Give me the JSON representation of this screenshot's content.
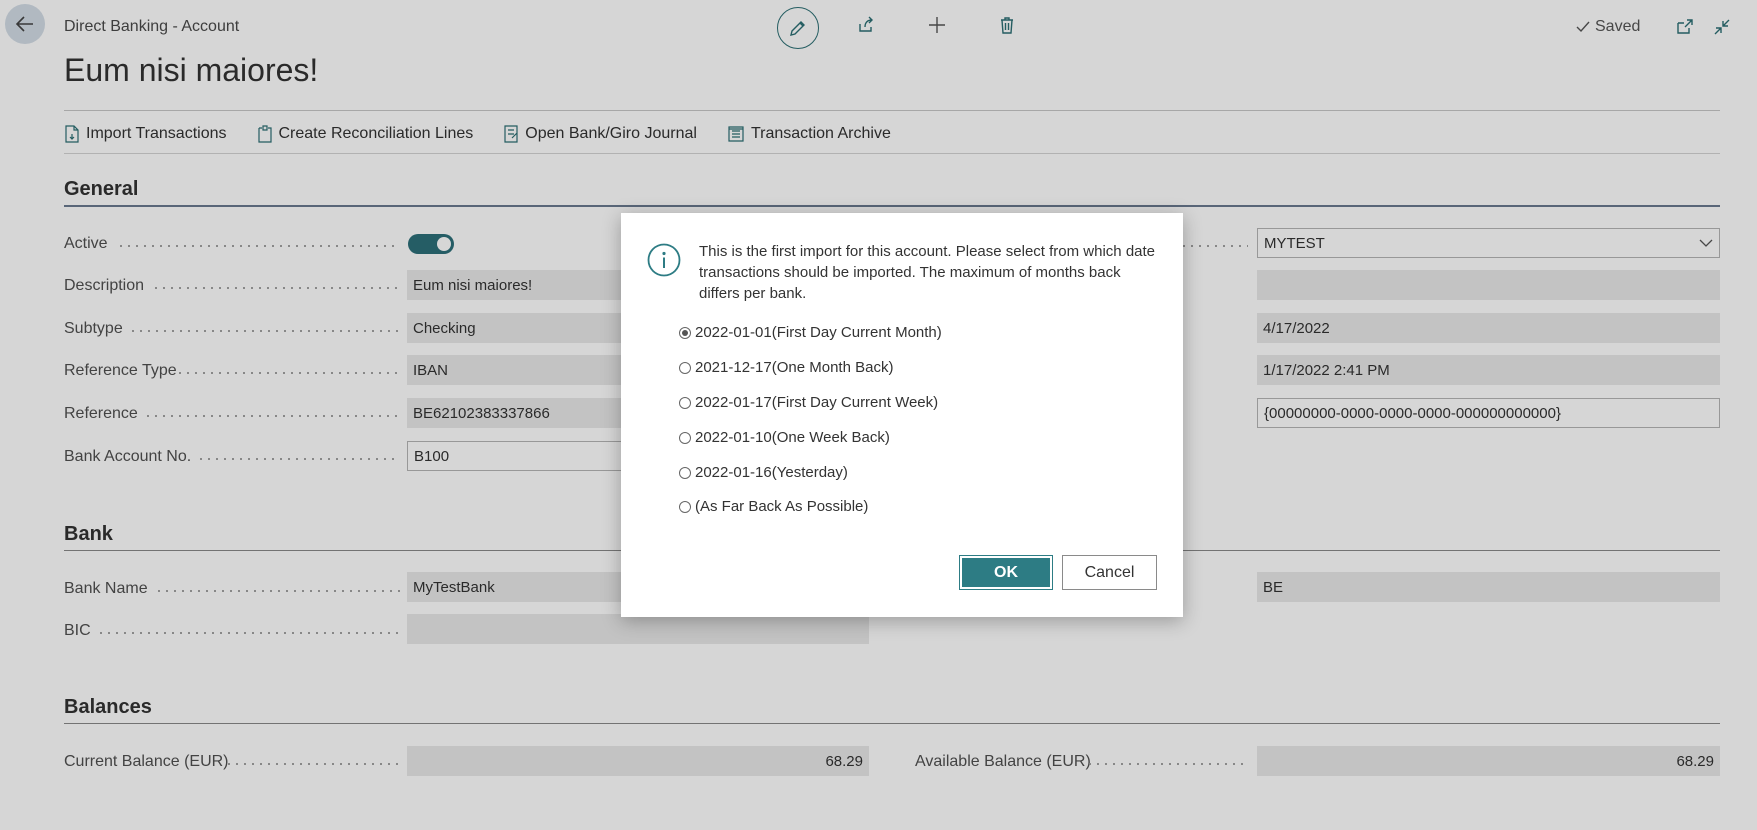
{
  "header": {
    "breadcrumb": "Direct Banking - Account",
    "title": "Eum nisi maiores!",
    "saved_label": "Saved"
  },
  "actions": [
    {
      "label": "Import Transactions",
      "icon": "import-file-icon"
    },
    {
      "label": "Create Reconciliation Lines",
      "icon": "create-lines-icon"
    },
    {
      "label": "Open Bank/Giro Journal",
      "icon": "journal-icon"
    },
    {
      "label": "Transaction Archive",
      "icon": "archive-icon"
    }
  ],
  "general": {
    "title": "General",
    "active_label": "Active",
    "active_value": true,
    "description_label": "Description",
    "description_value": "Eum nisi maiores!",
    "subtype_label": "Subtype",
    "subtype_value": "Checking",
    "reference_type_label": "Reference Type",
    "reference_type_value": "IBAN",
    "reference_label": "Reference",
    "reference_value": "BE62102383337866",
    "bank_account_label": "Bank Account No.",
    "bank_account_value": "B100",
    "right_values": {
      "select_value": "MYTEST",
      "empty_value": "",
      "date_value": "4/17/2022",
      "datetime_value": "1/17/2022 2:41 PM",
      "guid_value": "{00000000-0000-0000-0000-000000000000}"
    }
  },
  "bank": {
    "title": "Bank",
    "bank_name_label": "Bank Name",
    "bank_name_value": "MyTestBank",
    "bic_label": "BIC",
    "bic_value": "",
    "right_value": "BE"
  },
  "balances": {
    "title": "Balances",
    "current_label": "Current Balance (EUR)",
    "current_value": "68.29",
    "available_label": "Available Balance (EUR)",
    "available_value": "68.29"
  },
  "dialog": {
    "message": "This is the first import for this account. Please select from which date transactions should be imported. The maximum of months back differs per bank.",
    "options": [
      {
        "label": "2022-01-01(First Day Current Month)",
        "checked": true
      },
      {
        "label": "2021-12-17(One Month Back)",
        "checked": false
      },
      {
        "label": "2022-01-17(First Day Current Week)",
        "checked": false
      },
      {
        "label": "2022-01-10(One Week Back)",
        "checked": false
      },
      {
        "label": "2022-01-16(Yesterday)",
        "checked": false
      },
      {
        "label": "(As Far Back As Possible)",
        "checked": false
      }
    ],
    "ok_label": "OK",
    "cancel_label": "Cancel"
  },
  "colors": {
    "accent": "#2d7c84",
    "toggle_on": "#2d6f79"
  }
}
